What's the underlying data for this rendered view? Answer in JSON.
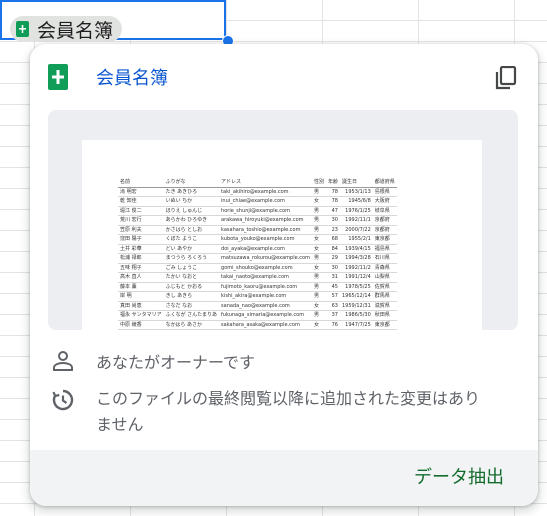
{
  "cell": {
    "chip_label": "会員名簿"
  },
  "card": {
    "title": "会員名簿",
    "owner_text": "あなたがオーナーです",
    "changes_text": "このファイルの最終閲覧以降に追加された変更はありません",
    "extract_label": "データ抽出"
  },
  "preview": {
    "headers": [
      "名前",
      "ふりがな",
      "アドレス",
      "性別",
      "年齢",
      "誕生日",
      "都道府県"
    ],
    "rows": [
      [
        "滝 明宏",
        "たき あきひろ",
        "taki_akihiro@example.com",
        "男",
        "78",
        "1953/1/13",
        "島根県"
      ],
      [
        "乾 知佳",
        "いぬい ちか",
        "inui_chiae@example.com",
        "女",
        "78",
        "1945/6/8",
        "大阪府"
      ],
      [
        "堀江 俊二",
        "ほりえ しゅんじ",
        "horie_shunji@example.com",
        "男",
        "47",
        "1976/1/25",
        "岐阜県"
      ],
      [
        "荒川 宏行",
        "あらかわ ひろゆき",
        "arakawa_hiroyuki@example.com",
        "男",
        "30",
        "1992/11/1",
        "京都府"
      ],
      [
        "笠原 利夫",
        "かさはら としお",
        "kasahara_toshio@example.com",
        "男",
        "23",
        "2000/7/22",
        "京都府"
      ],
      [
        "窪田 陽子",
        "くぼた ようこ",
        "kubota_youko@example.com",
        "女",
        "68",
        "1955/2/1",
        "東京都"
      ],
      [
        "土井 彩華",
        "どい あやか",
        "doi_ayaka@example.com",
        "女",
        "84",
        "1939/4/15",
        "福島県"
      ],
      [
        "松浦 禄郎",
        "まつうら ろくろう",
        "matsuzawa_rokurou@example.com",
        "男",
        "29",
        "1994/3/28",
        "石川県"
      ],
      [
        "五味 翔子",
        "ごみ しょうこ",
        "gomi_shouko@example.com",
        "女",
        "30",
        "1992/11/2",
        "青森県"
      ],
      [
        "高木 直人",
        "たかい なおと",
        "takai_naoto@example.com",
        "男",
        "31",
        "1991/12/4",
        "山梨県"
      ],
      [
        "藤本 薫",
        "ふじもと かおる",
        "fujimoto_kaoru@example.com",
        "男",
        "45",
        "1978/5/25",
        "佐賀県"
      ],
      [
        "岸 明",
        "きし あきら",
        "kishi_akira@example.com",
        "男",
        "57",
        "1965/12/14",
        "群馬県"
      ],
      [
        "真田 尚恵",
        "さなだ なお",
        "sanada_nao@example.com",
        "女",
        "63",
        "1959/12/31",
        "滋賀県"
      ],
      [
        "福永 サンタマリア",
        "ふくなが さんたまりあ",
        "fukunaga_simaria@example.com",
        "男",
        "37",
        "1986/5/30",
        "秋田県"
      ],
      [
        "中原 綾香",
        "なかはら あさか",
        "sakahara_asaka@example.com",
        "女",
        "76",
        "1947/7/25",
        "東京都"
      ],
      [
        "石川 丈史",
        "いしかわ たけし",
        "ishikawa_takeshi@example.com",
        "男",
        "27",
        "1996/4/3",
        "鳥取県"
      ]
    ]
  },
  "colors": {
    "selection": "#1a73e8",
    "title_link": "#0b57d0",
    "extract": "#146c2e",
    "sheets_green": "#0f9d58"
  },
  "icons": {
    "file": "sheets-icon",
    "copy": "copy-icon",
    "owner": "person-icon",
    "changes": "history-icon"
  }
}
